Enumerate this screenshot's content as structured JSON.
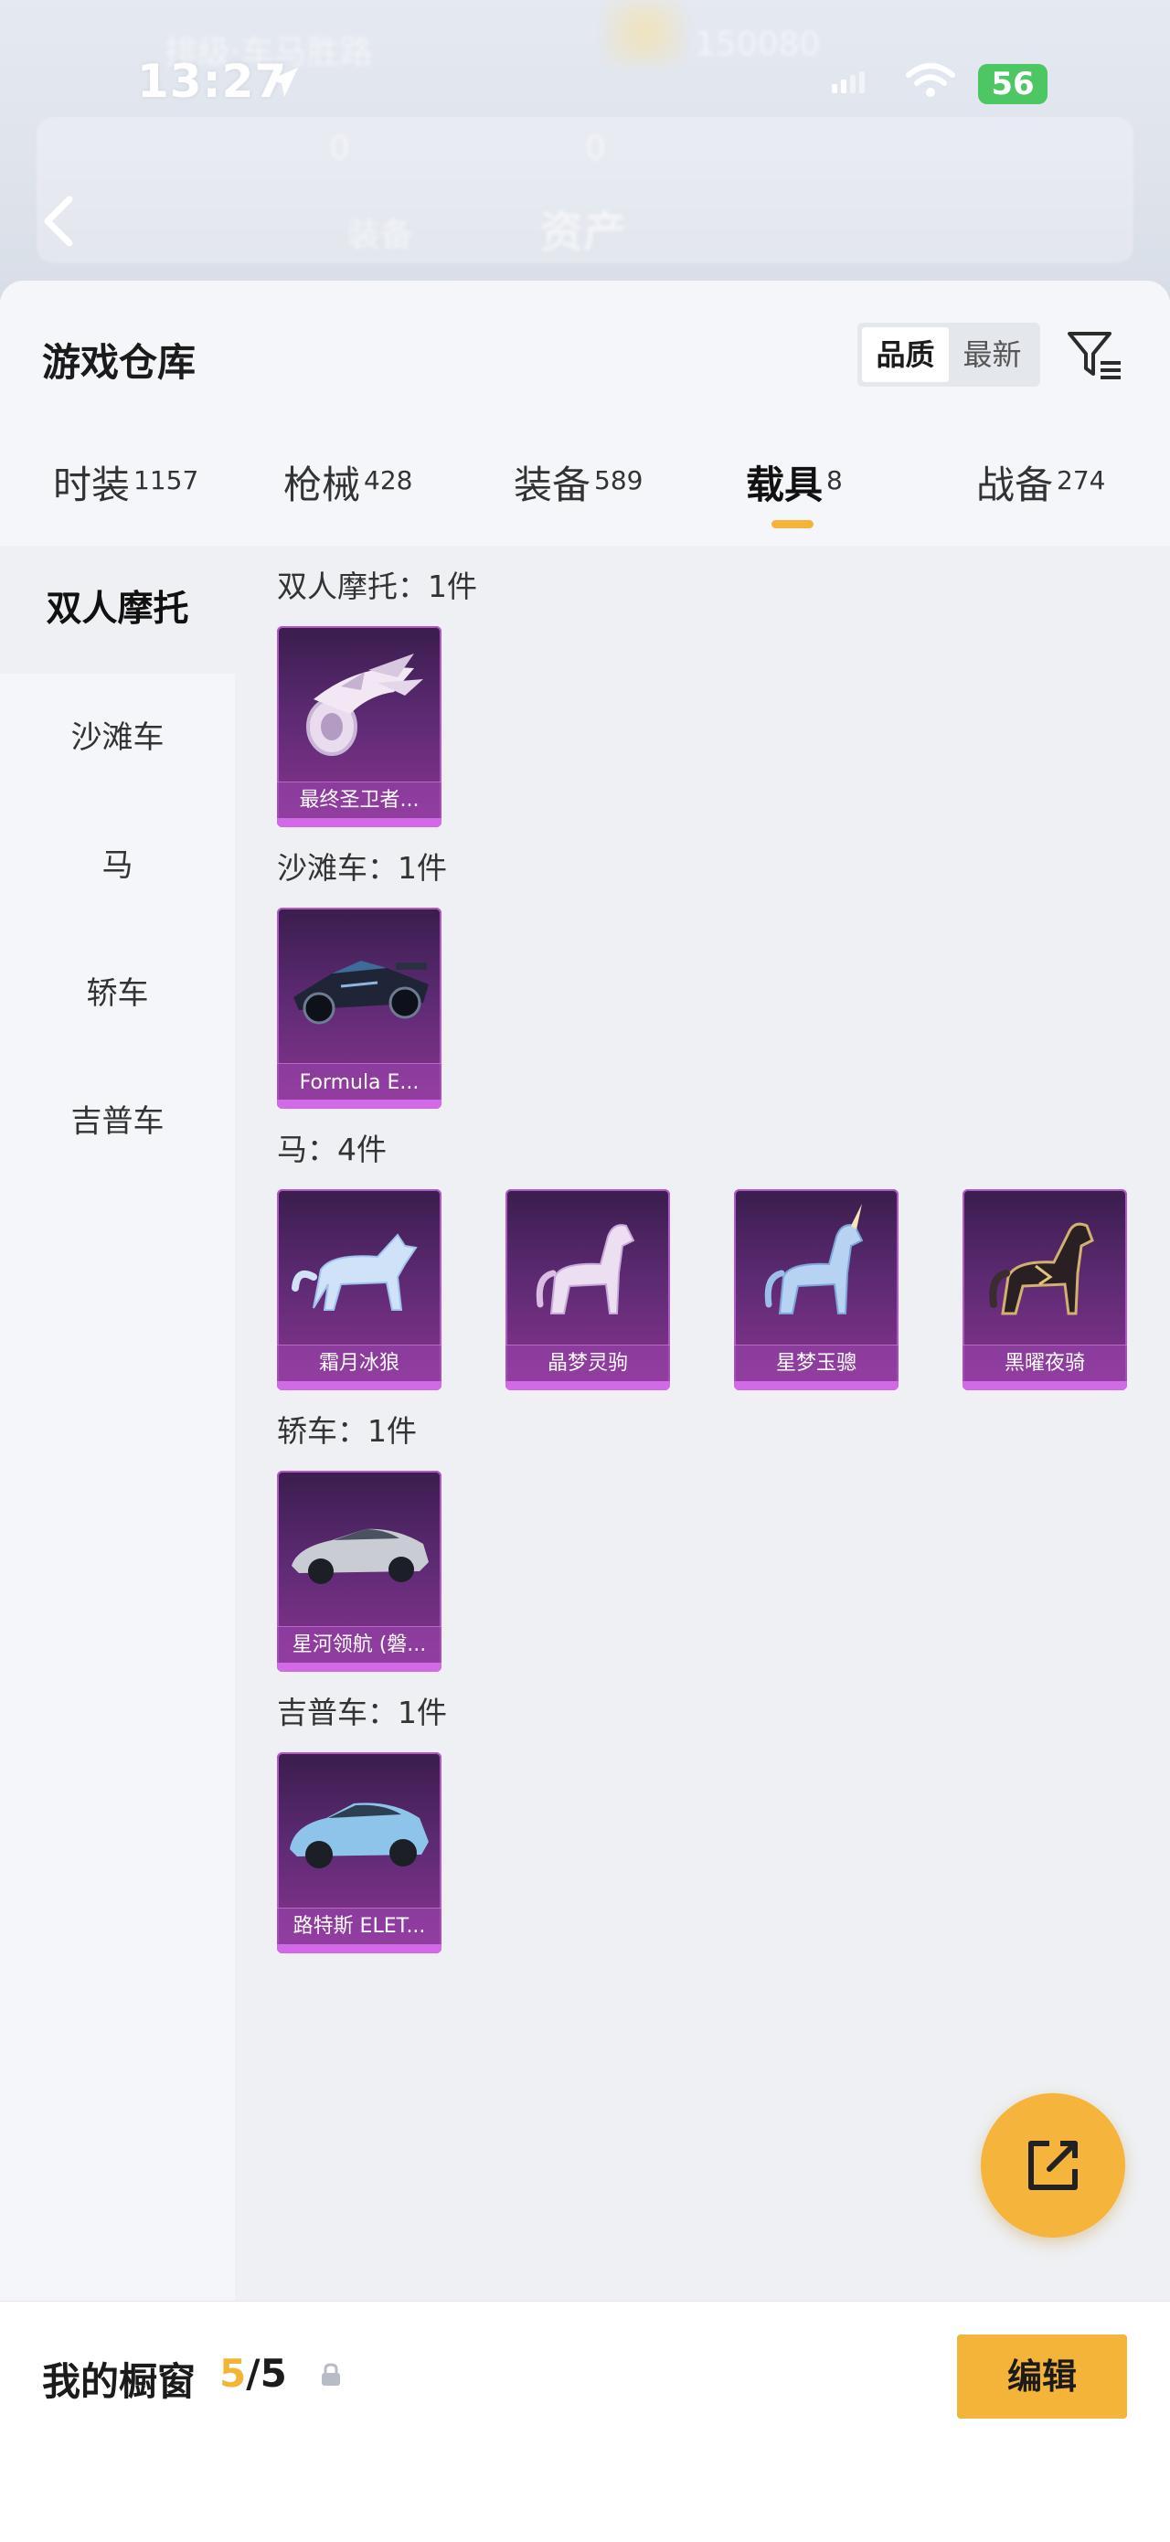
{
  "status_bar": {
    "time": "13:27",
    "battery": "56"
  },
  "background_header": {
    "ghost_texts": [
      "排级·车马胜路",
      "150080",
      "0",
      "0",
      "资产",
      "装备"
    ]
  },
  "sheet": {
    "title": "游戏仓库",
    "sort_options": [
      {
        "label": "品质",
        "active": true
      },
      {
        "label": "最新",
        "active": false
      }
    ]
  },
  "tabs": [
    {
      "label": "时装",
      "count": "1157",
      "active": false
    },
    {
      "label": "枪械",
      "count": "428",
      "active": false
    },
    {
      "label": "装备",
      "count": "589",
      "active": false
    },
    {
      "label": "载具",
      "count": "8",
      "active": true
    },
    {
      "label": "战备",
      "count": "274",
      "active": false
    }
  ],
  "sidebar": {
    "items": [
      {
        "label": "双人摩托",
        "active": true
      },
      {
        "label": "沙滩车",
        "active": false
      },
      {
        "label": "马",
        "active": false
      },
      {
        "label": "轿车",
        "active": false
      },
      {
        "label": "吉普车",
        "active": false
      }
    ]
  },
  "sections": [
    {
      "title": "双人摩托：1件",
      "items": [
        {
          "name": "最终圣卫者...",
          "icon": "motorcycle-icon"
        }
      ]
    },
    {
      "title": "沙滩车：1件",
      "items": [
        {
          "name": "Formula E...",
          "icon": "race-car-icon"
        }
      ]
    },
    {
      "title": "马：4件",
      "items": [
        {
          "name": "霜月冰狼",
          "icon": "wolf-icon"
        },
        {
          "name": "晶梦灵驹",
          "icon": "horse-icon"
        },
        {
          "name": "星梦玉骢",
          "icon": "unicorn-icon"
        },
        {
          "name": "黑曜夜骑",
          "icon": "dark-horse-icon"
        }
      ]
    },
    {
      "title": "轿车：1件",
      "items": [
        {
          "name": "星河领航 (磐...",
          "icon": "sedan-icon"
        }
      ]
    },
    {
      "title": "吉普车：1件",
      "items": [
        {
          "name": "路特斯 ELET...",
          "icon": "suv-icon"
        }
      ]
    }
  ],
  "bottom_bar": {
    "label": "我的橱窗",
    "current": "5",
    "separator_total": "/5",
    "edit_label": "编辑"
  },
  "colors": {
    "accent": "#f4b43a",
    "card_purple": "#5d2a73",
    "battery_green": "#4cc764"
  }
}
